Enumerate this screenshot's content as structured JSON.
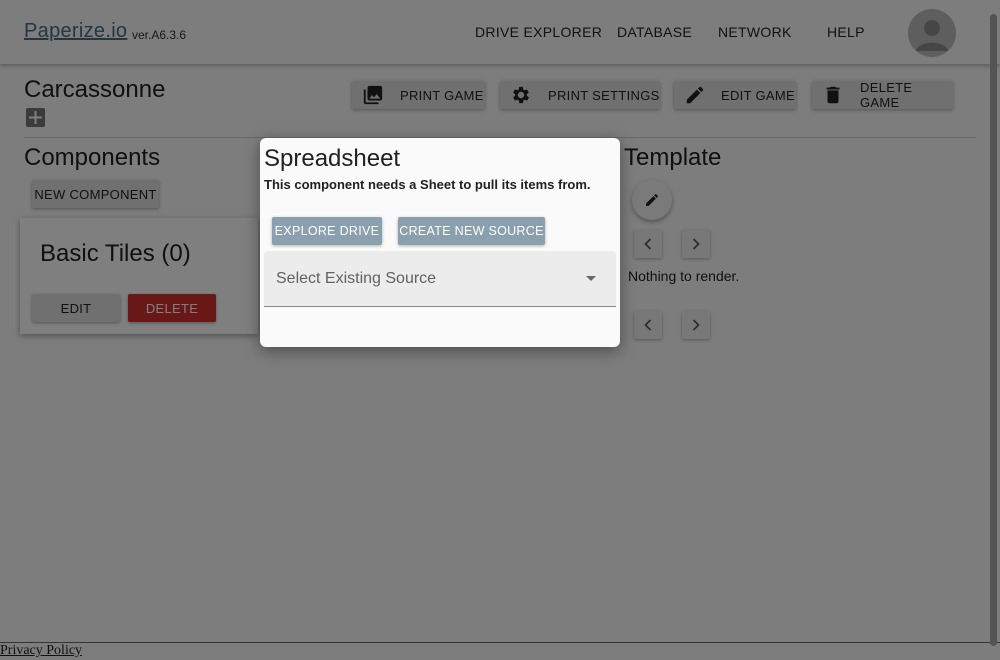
{
  "header": {
    "brand": "Paperize.io",
    "version": "ver.A6.3.6",
    "nav": [
      "DRIVE EXPLORER",
      "DATABASE",
      "NETWORK",
      "HELP"
    ]
  },
  "game": {
    "title": "Carcassonne",
    "actions": {
      "print_game": "PRINT GAME",
      "print_settings": "PRINT SETTINGS",
      "edit_game": "EDIT GAME",
      "delete_game": "DELETE GAME"
    }
  },
  "components": {
    "title": "Components",
    "new_button": "NEW COMPONENT",
    "cards": [
      {
        "title": "Basic Tiles (0)",
        "edit": "EDIT",
        "delete": "DELETE"
      }
    ]
  },
  "template": {
    "title": "Template",
    "empty_text": "Nothing to render."
  },
  "dialog": {
    "title": "Spreadsheet",
    "subtitle": "This component needs a Sheet to pull its items from.",
    "explore_button": "EXPLORE DRIVE",
    "create_button": "CREATE NEW SOURCE",
    "select_placeholder": "Select Existing Source"
  },
  "footer": {
    "privacy": "Privacy Policy"
  },
  "colors": {
    "brand": "#4a6a88",
    "delete_red": "#d32f2f",
    "dialog_button": "#8aa0ae"
  }
}
